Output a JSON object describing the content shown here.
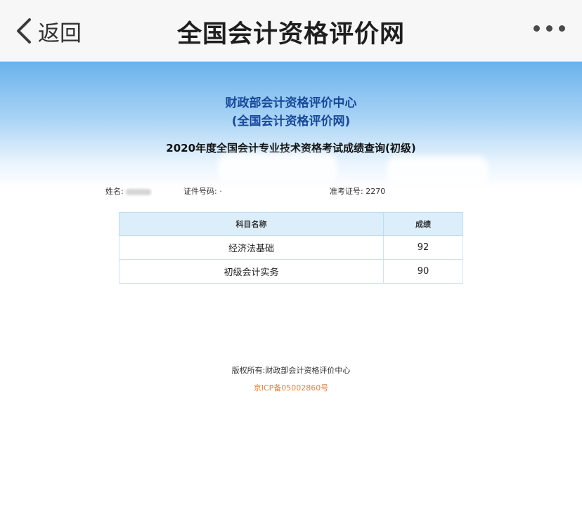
{
  "navbar": {
    "back_label": "返回",
    "title": "全国会计资格评价网"
  },
  "header": {
    "center_name": "财政部会计资格评价中心",
    "center_sub": "(全国会计资格评价网)",
    "exam_title": "2020年度全国会计专业技术资格考试成绩查询(初级)"
  },
  "info": {
    "name_label": "姓名:",
    "id_label": "证件号码:",
    "id_value": "·",
    "ticket_label": "准考证号:",
    "ticket_value": "2270"
  },
  "table": {
    "headers": [
      "科目名称",
      "成绩"
    ],
    "rows": [
      {
        "subject": "经济法基础",
        "score": "92"
      },
      {
        "subject": "初级会计实务",
        "score": "90"
      }
    ]
  },
  "footer": {
    "copyright": "版权所有:财政部会计资格评价中心",
    "icp": "京ICP备05002860号"
  },
  "colors": {
    "banner_top": "#6ab2ec",
    "title_blue": "#17489a",
    "table_header": "#dbeefa",
    "icp_orange": "#e2843c"
  }
}
